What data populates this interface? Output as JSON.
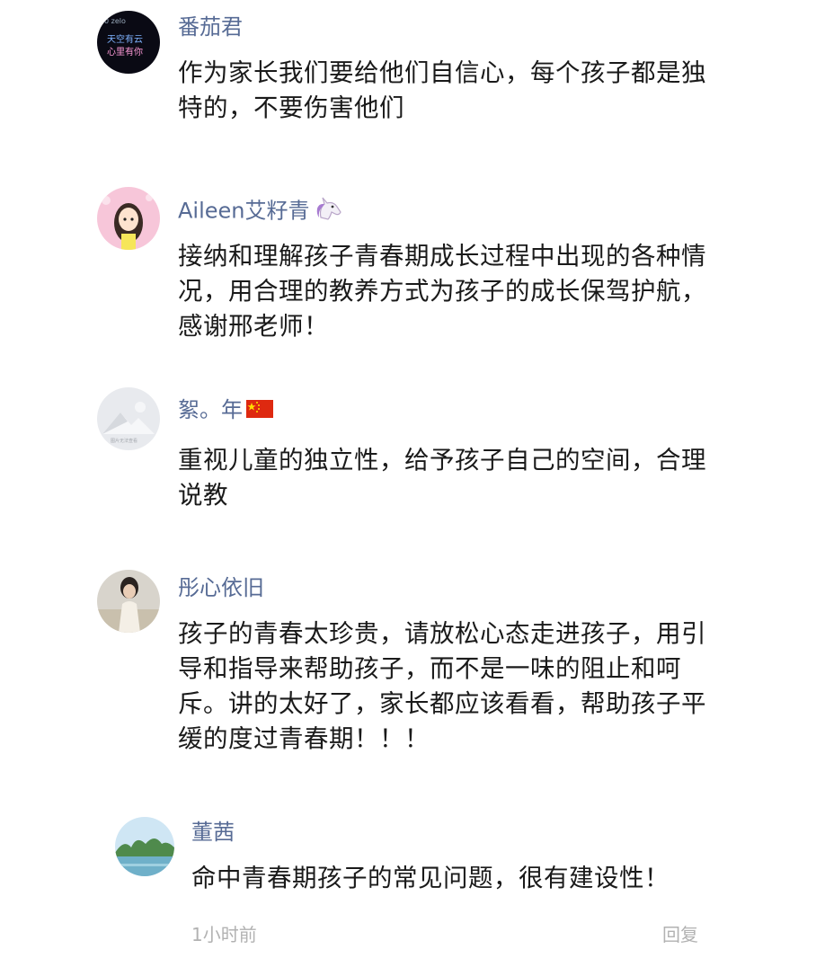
{
  "comments": [
    {
      "name": "番茄君",
      "text": "作为家长我们要给他们自信心，每个孩子都是独特的，不要伤害他们",
      "avatar": {
        "icon": "night-sky-text-avatar",
        "lines": [
          "天空有云",
          "心里有你"
        ],
        "top_text": "0 zelo"
      }
    },
    {
      "name": "Aileen艾籽青",
      "badge": "unicorn-emoji",
      "text": "接纳和理解孩子青春期成长过程中出现的各种情况，用合理的教养方式为孩子的成长保驾护航，感谢邢老师！",
      "avatar": {
        "icon": "cartoon-girl-avatar"
      }
    },
    {
      "name": "絮。年",
      "badge": "china-flag-emoji",
      "text": "重视儿童的独立性，给予孩子自己的空间，合理说教",
      "avatar": {
        "icon": "placeholder-mountain-avatar",
        "caption": "图片无法查看"
      }
    },
    {
      "name": "彤心依旧",
      "text": "孩子的青春太珍贵，请放松心态走进孩子，用引导和指导来帮助孩子，而不是一味的阻止和呵斥。讲的太好了，家长都应该看看，帮助孩子平缓的度过青春期！！！",
      "avatar": {
        "icon": "girl-photo-avatar"
      }
    }
  ],
  "reply": {
    "name": "董茜",
    "text": "命中青春期孩子的常见问题，很有建设性！",
    "avatar": {
      "icon": "landscape-lake-avatar"
    },
    "time": "1小时前",
    "reply_label": "回复"
  },
  "colors": {
    "name": "#576b95",
    "text": "#1a1a1a",
    "meta": "#b2b2b2"
  }
}
